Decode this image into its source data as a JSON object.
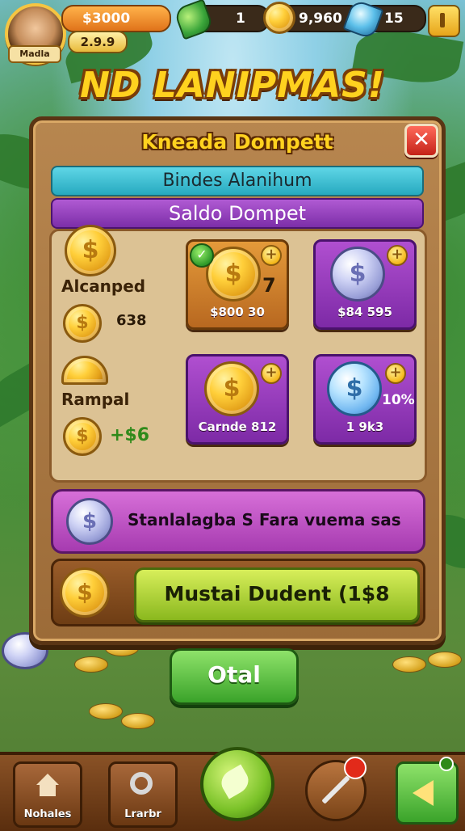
{
  "hud": {
    "player_name": "Madla",
    "coins": "$3000",
    "sub_value": "2.9.9",
    "gems": "1",
    "gold": "9,960",
    "blue_gems": "15"
  },
  "title": "ND LANIPMAS!",
  "panel": {
    "title": "Kneada Dompett",
    "close_symbol": "✕",
    "teal_bar": "Bindes Alanihum",
    "purple_bar": "Saldo Dompet",
    "left": {
      "label1": "Alcanped",
      "value1": "638",
      "label2": "Rampal",
      "value2": "+$6"
    },
    "cards": [
      {
        "badge_value": "7",
        "text": "$800 30"
      },
      {
        "text": "$84 595"
      },
      {
        "text": "Carnde 812"
      },
      {
        "badge_value": "10%",
        "text": "1 9k3"
      }
    ],
    "info_text": "Stanlalagba S Fara vuema sas",
    "main_button": "Mustai Dudent (1$8"
  },
  "ok_button": "Otal",
  "nav": {
    "home_label": "Nohales",
    "second_label": "Lrarbr"
  },
  "icons": {
    "check": "✓",
    "plus": "+",
    "dollar": "$"
  },
  "colors": {
    "accent_gold": "#ffd21f",
    "panel_brown": "#9c6b38",
    "purple": "#7d2aa6",
    "green": "#3aa32a"
  }
}
